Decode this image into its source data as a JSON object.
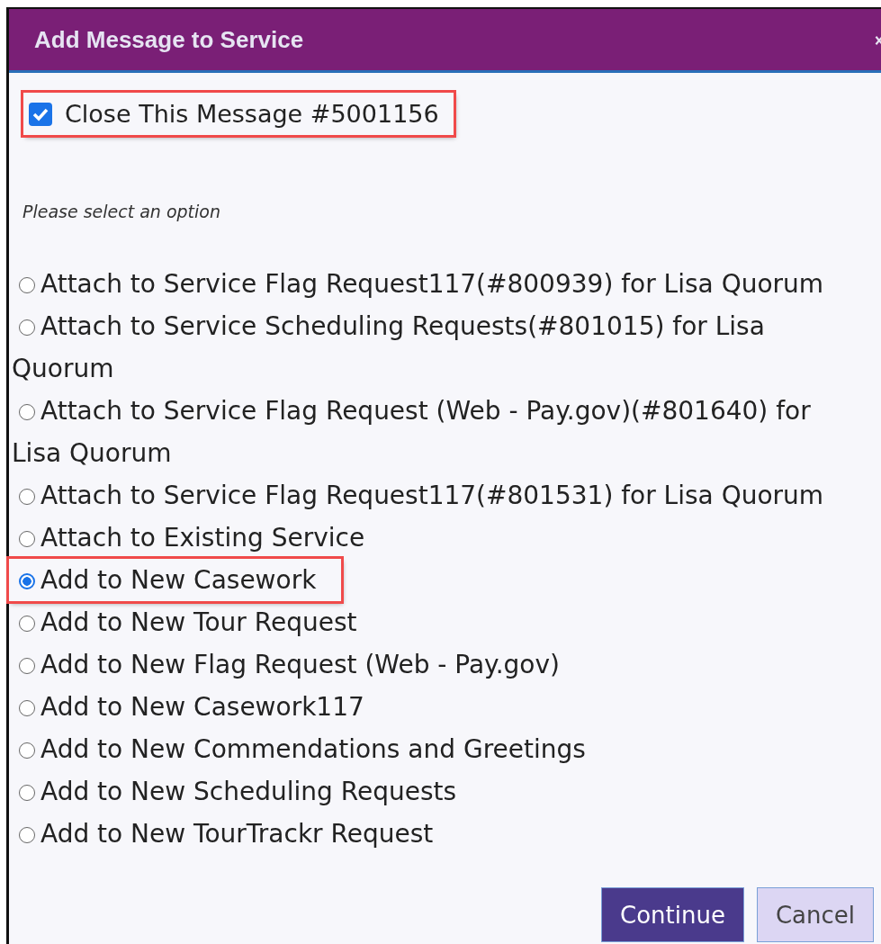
{
  "dialog": {
    "title": "Add Message to Service"
  },
  "close_checkbox": {
    "label": "Close This Message #5001156",
    "checked": true,
    "highlighted": true
  },
  "prompt": "Please select an option",
  "options": [
    {
      "label": "Attach to Service Flag Request117(#800939) for Lisa Quorum",
      "selected": false,
      "highlighted": false
    },
    {
      "label": "Attach to Service Scheduling Requests(#801015) for Lisa Quorum",
      "selected": false,
      "highlighted": false
    },
    {
      "label": "Attach to Service Flag Request (Web - Pay.gov)(#801640) for Lisa Quorum",
      "selected": false,
      "highlighted": false
    },
    {
      "label": "Attach to Service Flag Request117(#801531) for Lisa Quorum",
      "selected": false,
      "highlighted": false
    },
    {
      "label": "Attach to Existing Service",
      "selected": false,
      "highlighted": false
    },
    {
      "label": "Add to New Casework",
      "selected": true,
      "highlighted": true
    },
    {
      "label": "Add to New Tour Request",
      "selected": false,
      "highlighted": false
    },
    {
      "label": "Add to New Flag Request (Web - Pay.gov)",
      "selected": false,
      "highlighted": false
    },
    {
      "label": "Add to New Casework117",
      "selected": false,
      "highlighted": false
    },
    {
      "label": "Add to New Commendations and Greetings",
      "selected": false,
      "highlighted": false
    },
    {
      "label": "Add to New Scheduling Requests",
      "selected": false,
      "highlighted": false
    },
    {
      "label": "Add to New TourTrackr Request",
      "selected": false,
      "highlighted": false
    }
  ],
  "buttons": [
    {
      "label": "Continue",
      "kind": "primary"
    },
    {
      "label": "Cancel",
      "kind": "secondary"
    }
  ]
}
